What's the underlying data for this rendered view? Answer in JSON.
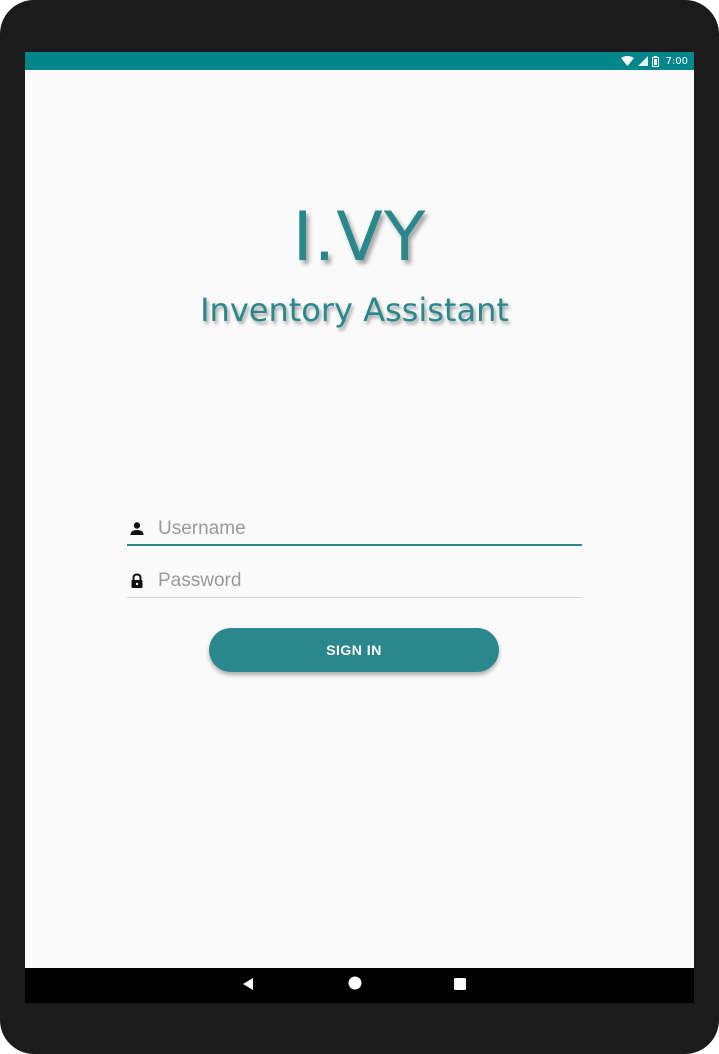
{
  "status_bar": {
    "time": "7:00",
    "icons": [
      "wifi-icon",
      "cell-signal-icon",
      "battery-icon"
    ],
    "background_color": "#00868b"
  },
  "app": {
    "title": "I.VY",
    "subtitle": "Inventory Assistant",
    "accent_color": "#2a888c"
  },
  "login_form": {
    "username": {
      "placeholder": "Username",
      "value": "",
      "icon": "person-icon"
    },
    "password": {
      "placeholder": "Password",
      "value": "",
      "icon": "lock-icon"
    },
    "sign_in_label": "SIGN IN"
  },
  "nav_bar": {
    "buttons": [
      "back-icon",
      "home-icon",
      "recents-icon"
    ]
  }
}
